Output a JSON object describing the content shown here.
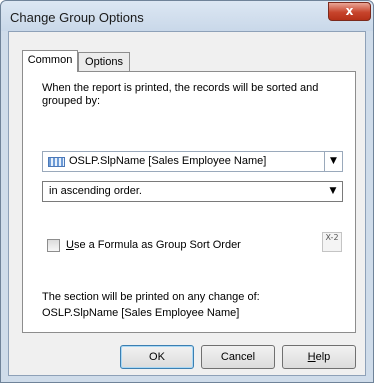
{
  "window": {
    "title": "Change Group Options",
    "close_glyph": "x"
  },
  "tabs": [
    {
      "label": "Common",
      "selected": true
    },
    {
      "label": "Options",
      "selected": false
    }
  ],
  "common": {
    "description": "When the report is printed, the records will be sorted and grouped by:",
    "group_field": {
      "value": "OSLP.SlpName [Sales Employee Name]",
      "icon": "database-field-icon"
    },
    "sort_order": {
      "value": "in ascending order."
    },
    "formula_checkbox": {
      "label_underlined": "U",
      "label_rest": "se a Formula as Group Sort Order",
      "checked": false
    },
    "formula_button_glyph_top": "X-2",
    "formula_button_glyph_bottom": "",
    "section_line1": "The section will be printed on any change of:",
    "section_line2": "OSLP.SlpName [Sales Employee Name]"
  },
  "buttons": {
    "ok": "OK",
    "cancel": "Cancel",
    "help_underlined": "H",
    "help_rest": "elp"
  },
  "dropdown_glyph": "▼"
}
